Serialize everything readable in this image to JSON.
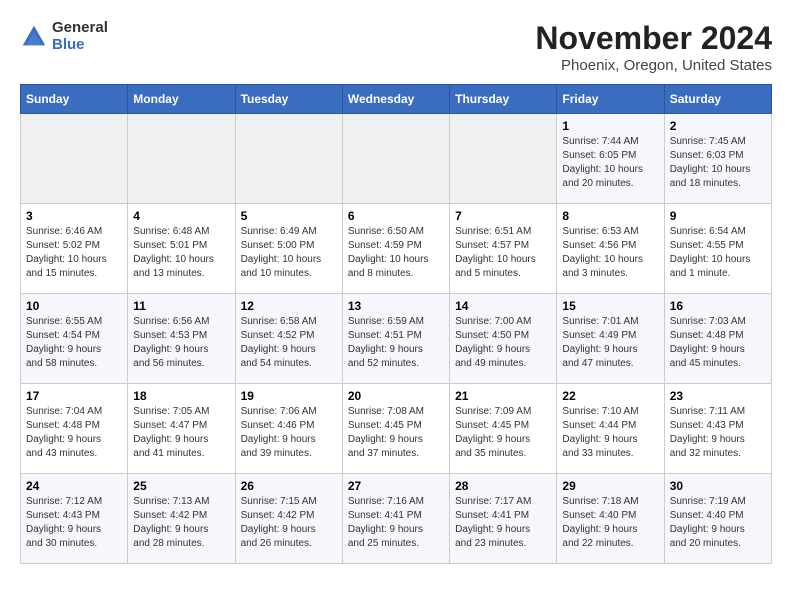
{
  "header": {
    "logo_general": "General",
    "logo_blue": "Blue",
    "title": "November 2024",
    "subtitle": "Phoenix, Oregon, United States"
  },
  "days_of_week": [
    "Sunday",
    "Monday",
    "Tuesday",
    "Wednesday",
    "Thursday",
    "Friday",
    "Saturday"
  ],
  "weeks": [
    {
      "cells": [
        {
          "day": null,
          "content": ""
        },
        {
          "day": null,
          "content": ""
        },
        {
          "day": null,
          "content": ""
        },
        {
          "day": null,
          "content": ""
        },
        {
          "day": null,
          "content": ""
        },
        {
          "day": "1",
          "content": "Sunrise: 7:44 AM\nSunset: 6:05 PM\nDaylight: 10 hours\nand 20 minutes."
        },
        {
          "day": "2",
          "content": "Sunrise: 7:45 AM\nSunset: 6:03 PM\nDaylight: 10 hours\nand 18 minutes."
        }
      ]
    },
    {
      "cells": [
        {
          "day": "3",
          "content": "Sunrise: 6:46 AM\nSunset: 5:02 PM\nDaylight: 10 hours\nand 15 minutes."
        },
        {
          "day": "4",
          "content": "Sunrise: 6:48 AM\nSunset: 5:01 PM\nDaylight: 10 hours\nand 13 minutes."
        },
        {
          "day": "5",
          "content": "Sunrise: 6:49 AM\nSunset: 5:00 PM\nDaylight: 10 hours\nand 10 minutes."
        },
        {
          "day": "6",
          "content": "Sunrise: 6:50 AM\nSunset: 4:59 PM\nDaylight: 10 hours\nand 8 minutes."
        },
        {
          "day": "7",
          "content": "Sunrise: 6:51 AM\nSunset: 4:57 PM\nDaylight: 10 hours\nand 5 minutes."
        },
        {
          "day": "8",
          "content": "Sunrise: 6:53 AM\nSunset: 4:56 PM\nDaylight: 10 hours\nand 3 minutes."
        },
        {
          "day": "9",
          "content": "Sunrise: 6:54 AM\nSunset: 4:55 PM\nDaylight: 10 hours\nand 1 minute."
        }
      ]
    },
    {
      "cells": [
        {
          "day": "10",
          "content": "Sunrise: 6:55 AM\nSunset: 4:54 PM\nDaylight: 9 hours\nand 58 minutes."
        },
        {
          "day": "11",
          "content": "Sunrise: 6:56 AM\nSunset: 4:53 PM\nDaylight: 9 hours\nand 56 minutes."
        },
        {
          "day": "12",
          "content": "Sunrise: 6:58 AM\nSunset: 4:52 PM\nDaylight: 9 hours\nand 54 minutes."
        },
        {
          "day": "13",
          "content": "Sunrise: 6:59 AM\nSunset: 4:51 PM\nDaylight: 9 hours\nand 52 minutes."
        },
        {
          "day": "14",
          "content": "Sunrise: 7:00 AM\nSunset: 4:50 PM\nDaylight: 9 hours\nand 49 minutes."
        },
        {
          "day": "15",
          "content": "Sunrise: 7:01 AM\nSunset: 4:49 PM\nDaylight: 9 hours\nand 47 minutes."
        },
        {
          "day": "16",
          "content": "Sunrise: 7:03 AM\nSunset: 4:48 PM\nDaylight: 9 hours\nand 45 minutes."
        }
      ]
    },
    {
      "cells": [
        {
          "day": "17",
          "content": "Sunrise: 7:04 AM\nSunset: 4:48 PM\nDaylight: 9 hours\nand 43 minutes."
        },
        {
          "day": "18",
          "content": "Sunrise: 7:05 AM\nSunset: 4:47 PM\nDaylight: 9 hours\nand 41 minutes."
        },
        {
          "day": "19",
          "content": "Sunrise: 7:06 AM\nSunset: 4:46 PM\nDaylight: 9 hours\nand 39 minutes."
        },
        {
          "day": "20",
          "content": "Sunrise: 7:08 AM\nSunset: 4:45 PM\nDaylight: 9 hours\nand 37 minutes."
        },
        {
          "day": "21",
          "content": "Sunrise: 7:09 AM\nSunset: 4:45 PM\nDaylight: 9 hours\nand 35 minutes."
        },
        {
          "day": "22",
          "content": "Sunrise: 7:10 AM\nSunset: 4:44 PM\nDaylight: 9 hours\nand 33 minutes."
        },
        {
          "day": "23",
          "content": "Sunrise: 7:11 AM\nSunset: 4:43 PM\nDaylight: 9 hours\nand 32 minutes."
        }
      ]
    },
    {
      "cells": [
        {
          "day": "24",
          "content": "Sunrise: 7:12 AM\nSunset: 4:43 PM\nDaylight: 9 hours\nand 30 minutes."
        },
        {
          "day": "25",
          "content": "Sunrise: 7:13 AM\nSunset: 4:42 PM\nDaylight: 9 hours\nand 28 minutes."
        },
        {
          "day": "26",
          "content": "Sunrise: 7:15 AM\nSunset: 4:42 PM\nDaylight: 9 hours\nand 26 minutes."
        },
        {
          "day": "27",
          "content": "Sunrise: 7:16 AM\nSunset: 4:41 PM\nDaylight: 9 hours\nand 25 minutes."
        },
        {
          "day": "28",
          "content": "Sunrise: 7:17 AM\nSunset: 4:41 PM\nDaylight: 9 hours\nand 23 minutes."
        },
        {
          "day": "29",
          "content": "Sunrise: 7:18 AM\nSunset: 4:40 PM\nDaylight: 9 hours\nand 22 minutes."
        },
        {
          "day": "30",
          "content": "Sunrise: 7:19 AM\nSunset: 4:40 PM\nDaylight: 9 hours\nand 20 minutes."
        }
      ]
    }
  ]
}
